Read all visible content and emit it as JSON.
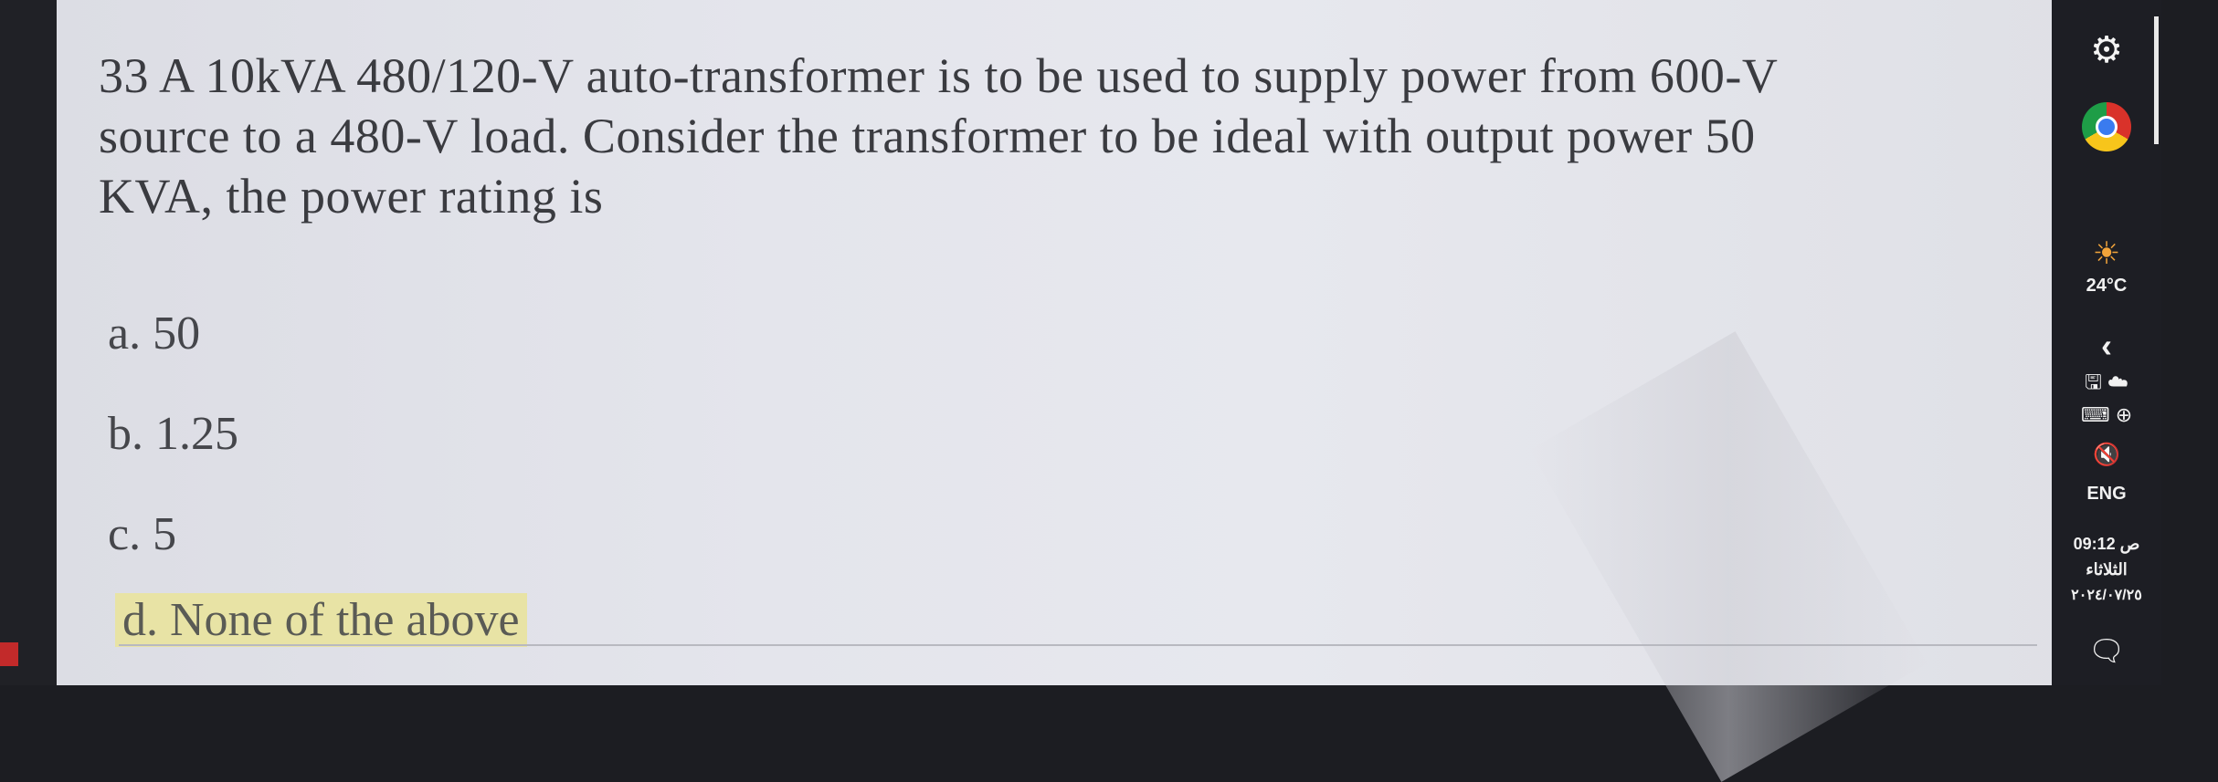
{
  "question": {
    "line1": "33 A 10kVA 480/120-V auto-transformer is to be used to supply power from 600-V",
    "line2": "source to a 480-V load. Consider the transformer to be ideal with output power 50",
    "line3": "KVA, the power rating is"
  },
  "options": [
    {
      "label": "a. 50"
    },
    {
      "label": "b. 1.25"
    },
    {
      "label": "c. 5"
    },
    {
      "label": "d. None of the above",
      "highlighted": true
    }
  ],
  "taskbar": {
    "temperature": "24°C",
    "language": "ENG",
    "time": "09:12 ص",
    "day": "الثلاثاء",
    "date": "٢٠٢٤/٠٧/٢٥"
  },
  "colors": {
    "highlight": "#e8e3a5",
    "screen_bg": "#e4e5ec",
    "taskbar_bg": "#1d1e24"
  }
}
